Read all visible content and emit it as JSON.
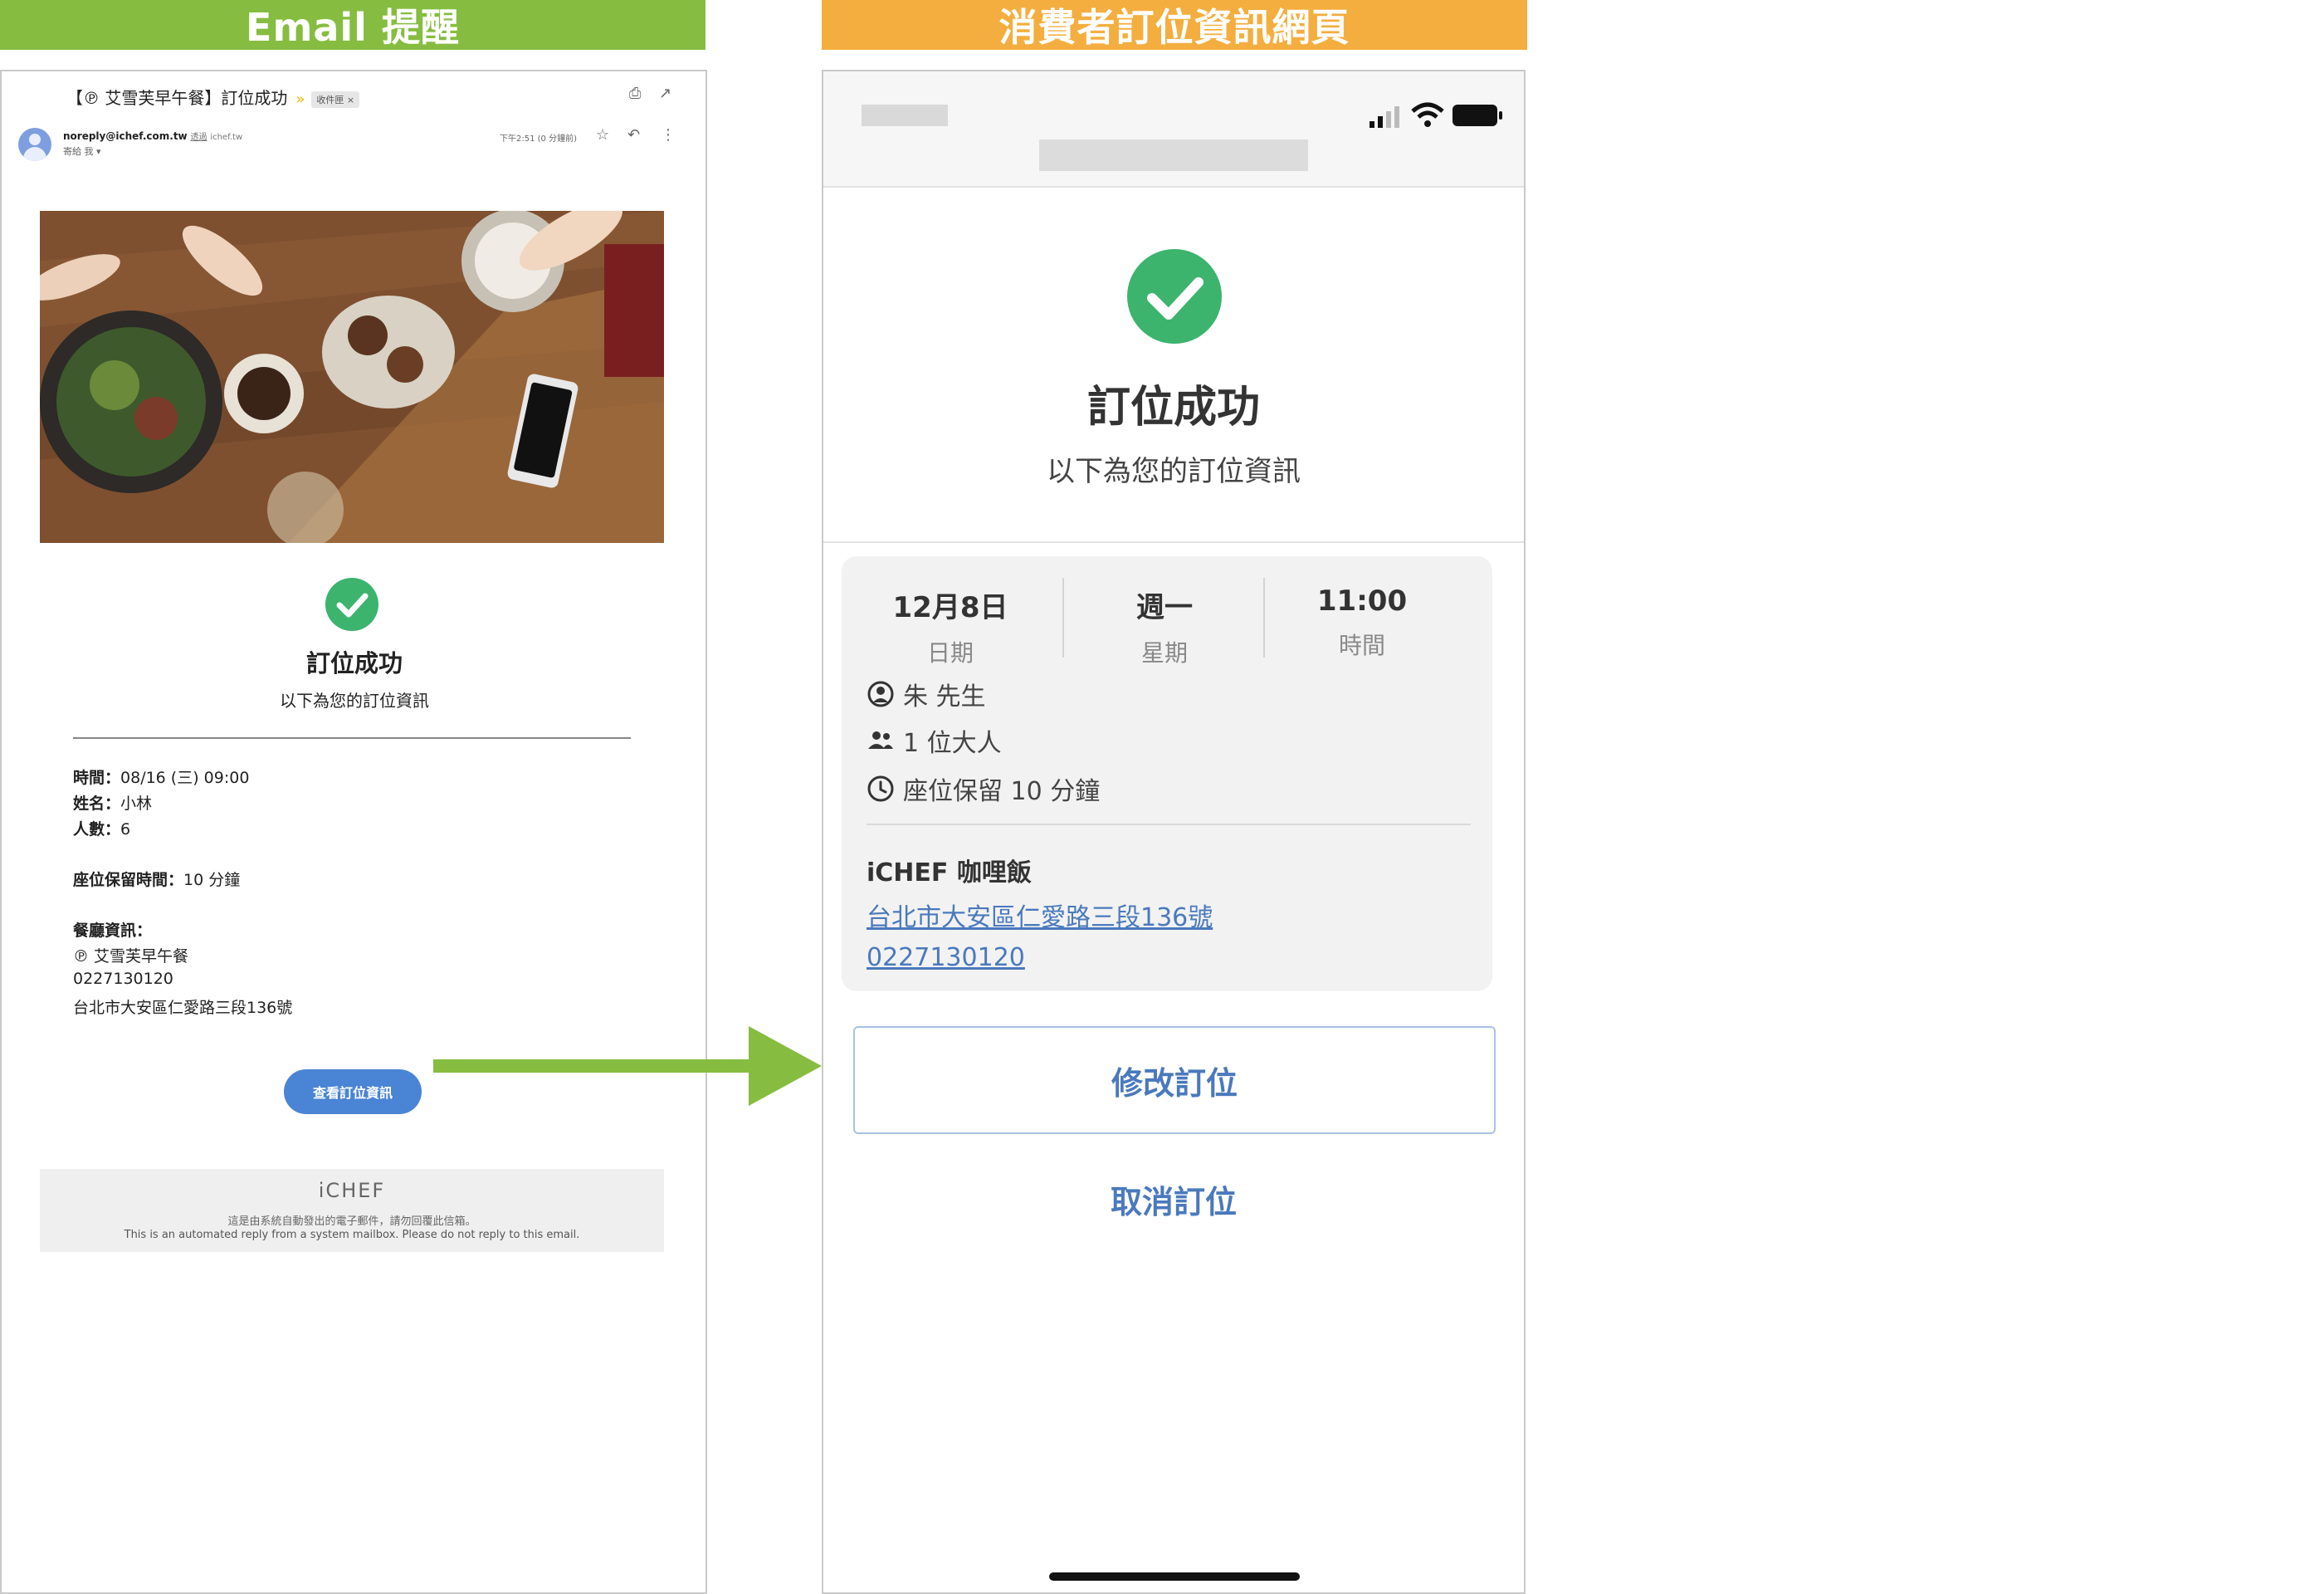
{
  "banners": {
    "email": "Email 提醒",
    "web": "消費者訂位資訊網頁"
  },
  "email": {
    "subject": "【℗ 艾雪芙早午餐】訂位成功",
    "inbox_badge": "收件匣 ×",
    "sender_email": "noreply@ichef.com.tw",
    "sender_via": "透過",
    "sender_domain": "ichef.tw",
    "to_line": "寄給 我 ▾",
    "time": "下午2:51 (0 分鐘前)",
    "success_title": "訂位成功",
    "success_subtitle": "以下為您的訂位資訊",
    "details": {
      "time_label": "時間：",
      "time_value": "08/16 (三) 09:00",
      "name_label": "姓名：",
      "name_value": "小林",
      "people_label": "人數：",
      "people_value": "6",
      "hold_label": "座位保留時間：",
      "hold_value": "10 分鐘",
      "restaurant_label": "餐廳資訊：",
      "restaurant_name": "℗ 艾雪芙早午餐",
      "restaurant_phone": "0227130120",
      "restaurant_address": "台北市大安區仁愛路三段136號"
    },
    "view_button": "查看訂位資訊",
    "footer": {
      "logo": "iCHEF",
      "line_zh": "這是由系統自動發出的電子郵件，請勿回覆此信箱。",
      "line_en": "This is an automated reply from a system mailbox. Please do not reply to this email."
    }
  },
  "web": {
    "success_title": "訂位成功",
    "success_subtitle": "以下為您的訂位資訊",
    "date_value": "12月8日",
    "date_label": "日期",
    "weekday_value": "週一",
    "weekday_label": "星期",
    "time_value": "11:00",
    "time_label": "時間",
    "guest_name": "朱 先生",
    "party_size": "1 位大人",
    "hold_time": "座位保留 10 分鐘",
    "restaurant_name": "iCHEF 咖哩飯",
    "address": "台北市大安區仁愛路三段136號",
    "phone": "0227130120",
    "modify_button": "修改訂位",
    "cancel_button": "取消訂位"
  },
  "colors": {
    "email_banner": "#86bd40",
    "web_banner": "#f4ae3f",
    "success_green": "#3cb46e",
    "link_blue": "#4a79bd",
    "email_button_blue": "#4a84d4",
    "arrow_green": "#86bd40"
  },
  "icons": [
    "print-icon",
    "open-new-window-icon",
    "star-icon",
    "reply-icon",
    "more-vert-icon",
    "user-circle-icon",
    "people-icon",
    "clock-icon",
    "check-icon",
    "signal-icon",
    "wifi-icon",
    "battery-icon"
  ]
}
